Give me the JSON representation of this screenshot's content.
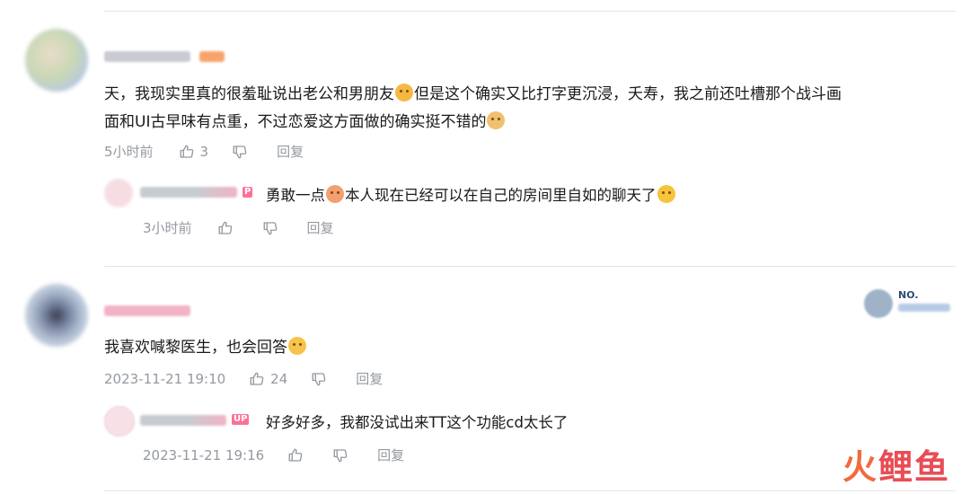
{
  "comments": [
    {
      "text_a": "天，我现实里真的很羞耻说出老公和男朋友",
      "text_b": "但是这个确实又比打字更沉浸，夭寿，我之前还吐槽那个战斗画",
      "text_c": "面和UI古早味有点重，不过恋爱这方面做的确实挺不错的",
      "time": "5小时前",
      "likes": "3",
      "reply_label": "回复",
      "reply": {
        "badge": "P",
        "text_a": "勇敢一点",
        "text_b": "本人现在已经可以在自己的房间里自如的聊天了",
        "time": "3小时前",
        "reply_label": "回复"
      }
    },
    {
      "text_a": "我喜欢喊黎医生，也会回答",
      "time": "2023-11-21 19:10",
      "likes": "24",
      "reply_label": "回复",
      "fan_medal_label": "NO.",
      "reply": {
        "badge": "UP",
        "text_a": "好多好多，我都没试出来TT这个功能cd太长了",
        "time": "2023-11-21 19:16",
        "reply_label": "回复"
      }
    }
  ],
  "watermark": {
    "char_1": "火",
    "char_2": "鲤鱼"
  },
  "icons": [
    "thumb-up-icon",
    "thumb-down-icon"
  ],
  "colors": {
    "accent": "#fb7299",
    "meta": "#9499a0",
    "divider": "#e3e5e7"
  }
}
